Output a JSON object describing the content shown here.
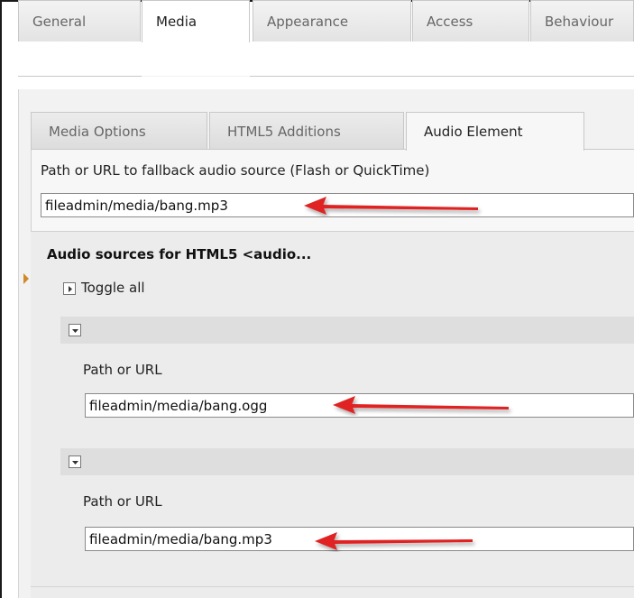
{
  "top_tabs": [
    {
      "label": "General",
      "active": false
    },
    {
      "label": "Media",
      "active": true
    },
    {
      "label": "Appearance",
      "active": false
    },
    {
      "label": "Access",
      "active": false
    },
    {
      "label": "Behaviour",
      "active": false
    }
  ],
  "sub_tabs": [
    {
      "label": "Media Options",
      "active": false
    },
    {
      "label": "HTML5 Additions",
      "active": false
    },
    {
      "label": "Audio Element",
      "active": true
    }
  ],
  "fallback": {
    "label": "Path or URL to fallback audio source (Flash or QuickTime)",
    "value": "fileadmin/media/bang.mp3"
  },
  "sources_section": {
    "title": "Audio sources for HTML5 <audio...",
    "toggle_all_label": "Toggle all",
    "items": [
      {
        "label": "Path or URL",
        "value": "fileadmin/media/bang.ogg"
      },
      {
        "label": "Path or URL",
        "value": "fileadmin/media/bang.mp3"
      }
    ]
  },
  "annotation_color": "#e02020",
  "icons": {
    "toggle_all": "expand-arrow-right-icon",
    "item_collapse": "collapse-arrow-down-icon",
    "annotation": "red-arrow-pointer-icon",
    "section_marker": "orange-triangle-marker-icon"
  }
}
